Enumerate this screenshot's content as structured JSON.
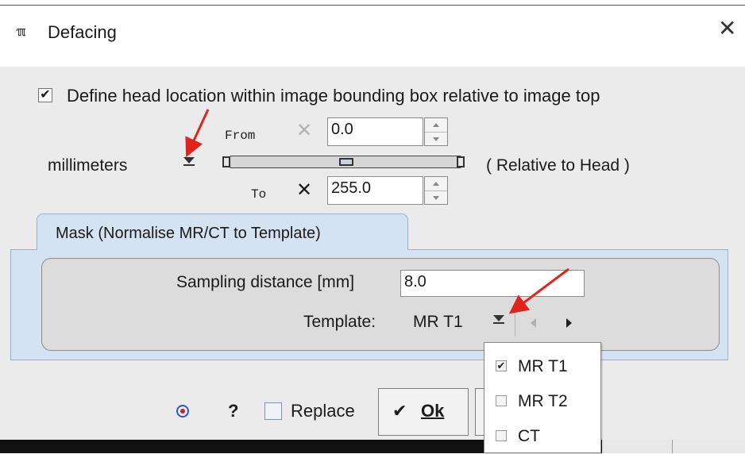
{
  "window": {
    "title": "Defacing",
    "app_icon_text": "ℼ",
    "close_symbol": "✕"
  },
  "head_location": {
    "checkbox_label": "Define head location within image bounding box relative to image top",
    "checked": true,
    "check_symbol": "✔",
    "from_label": "From",
    "from_value": "0.0",
    "from_clear_symbol": "✕",
    "to_label": "To",
    "to_value": "255.0",
    "to_clear_symbol": "✕",
    "units": "millimeters",
    "relative_label": "( Relative to Head )"
  },
  "mask_tab": {
    "label": "Mask (Normalise MR/CT to Template)",
    "sampling_label": "Sampling distance [mm]",
    "sampling_value": "8.0",
    "template_label": "Template:",
    "template_value": "MR T1",
    "template_options": [
      {
        "label": "MR T1",
        "checked": true,
        "mark": "✔"
      },
      {
        "label": "MR T2",
        "checked": false,
        "mark": ""
      },
      {
        "label": "CT",
        "checked": false,
        "mark": ""
      }
    ]
  },
  "footer": {
    "help_symbol": "?",
    "replace_label": "Replace",
    "replace_checked": false,
    "ok_check_symbol": "✔",
    "ok_label": "Ok"
  },
  "icons": {
    "app": "app-logo-icon",
    "close": "close-icon",
    "target": "target-icon",
    "help": "help-icon",
    "dropdown": "chevron-down-icon",
    "prev": "arrow-left-icon",
    "next": "arrow-right-icon"
  },
  "colors": {
    "dialog_bg": "#ebebeb",
    "tab_bg": "#d5e2f2",
    "panel_bg": "#dcdcdc",
    "annotation_arrow": "#e0241c",
    "target_ring": "#3355cc",
    "target_dot": "#d0202a"
  }
}
